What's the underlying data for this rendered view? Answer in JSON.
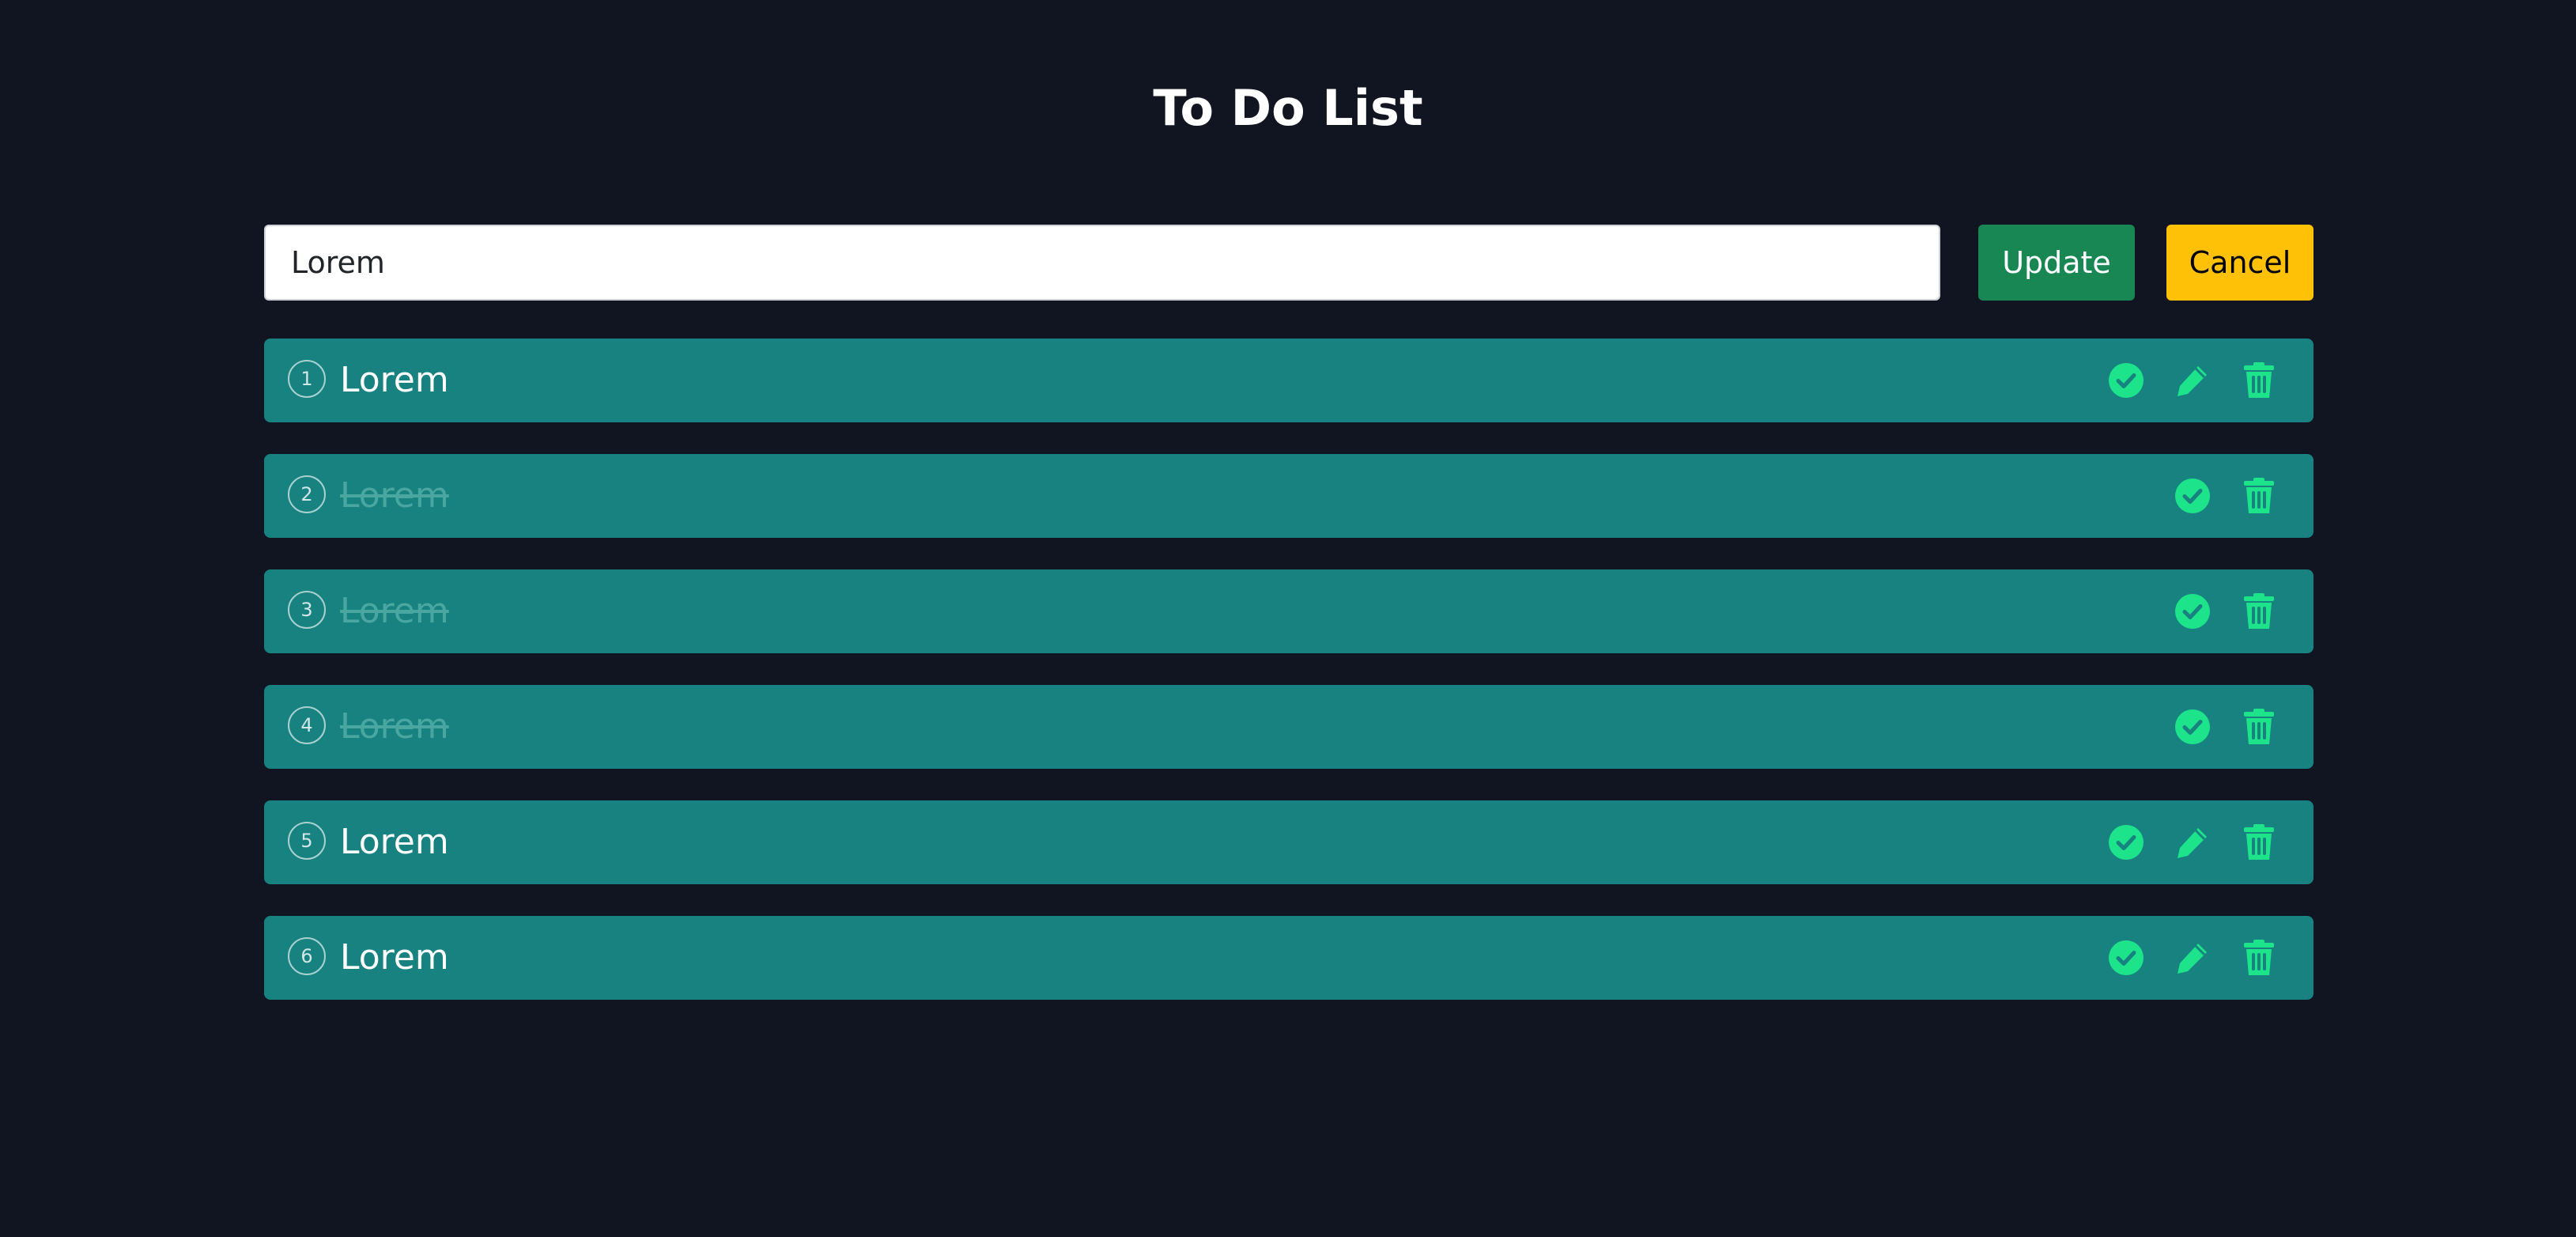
{
  "title": "To Do List",
  "edit": {
    "value": "Lorem",
    "update_label": "Update",
    "cancel_label": "Cancel"
  },
  "colors": {
    "background": "#111421",
    "task_bg": "#178280",
    "icon": "#1de48a",
    "update_btn": "#198754",
    "cancel_btn": "#ffc107"
  },
  "icons": {
    "complete": "check-circle-icon",
    "edit": "pencil-icon",
    "delete": "trash-icon"
  },
  "tasks": [
    {
      "number": "1",
      "text": "Lorem",
      "completed": false
    },
    {
      "number": "2",
      "text": "Lorem",
      "completed": true
    },
    {
      "number": "3",
      "text": "Lorem",
      "completed": true
    },
    {
      "number": "4",
      "text": "Lorem",
      "completed": true
    },
    {
      "number": "5",
      "text": "Lorem",
      "completed": false
    },
    {
      "number": "6",
      "text": "Lorem",
      "completed": false
    }
  ]
}
